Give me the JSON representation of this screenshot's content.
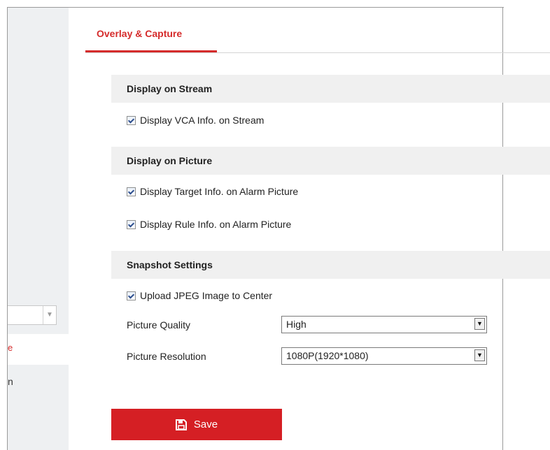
{
  "left_panel": {
    "dropdown_arrow": "chevron-down-icon",
    "red_item_tail": "e",
    "item_tail": "n"
  },
  "tabs": [
    {
      "label": "Overlay & Capture",
      "active": true
    }
  ],
  "sections": {
    "display_on_stream": {
      "title": "Display on Stream",
      "options": [
        {
          "label": "Display VCA Info. on Stream",
          "checked": true
        }
      ]
    },
    "display_on_picture": {
      "title": "Display on Picture",
      "options": [
        {
          "label": "Display Target Info. on Alarm Picture",
          "checked": true
        },
        {
          "label": "Display Rule Info. on Alarm Picture",
          "checked": true
        }
      ]
    },
    "snapshot_settings": {
      "title": "Snapshot Settings",
      "options": [
        {
          "label": "Upload JPEG Image to Center",
          "checked": true
        }
      ],
      "picture_quality": {
        "label": "Picture Quality",
        "value": "High"
      },
      "picture_resolution": {
        "label": "Picture Resolution",
        "value": "1080P(1920*1080)"
      }
    }
  },
  "save_button": {
    "label": "Save",
    "icon": "floppy-disk-icon"
  },
  "colors": {
    "accent": "#d52b2b",
    "save_button_bg": "#d51f24",
    "section_header_bg": "#f0f0f0",
    "left_panel_bg": "#eef0f2"
  }
}
